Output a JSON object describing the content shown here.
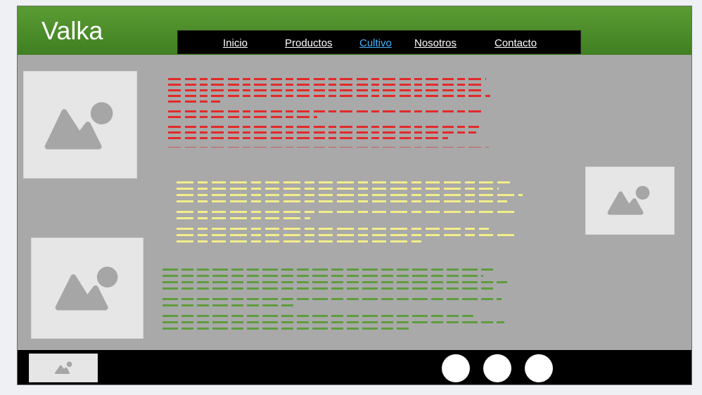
{
  "site": {
    "logo_text": "Valka"
  },
  "nav": {
    "items": [
      {
        "label": "Inicio",
        "active": false
      },
      {
        "label": "Productos",
        "active": false
      },
      {
        "label": "Cultivo",
        "active": true
      },
      {
        "label": "Nosotros",
        "active": false
      },
      {
        "label": "Contacto",
        "active": false
      }
    ],
    "active_color": "#43b4ff"
  },
  "images": [
    {
      "icon": "image-placeholder-icon"
    },
    {
      "icon": "image-placeholder-icon"
    },
    {
      "icon": "image-placeholder-icon"
    },
    {
      "icon": "image-placeholder-icon"
    }
  ],
  "footer": {
    "social_buttons": [
      {
        "icon": "circle-icon"
      },
      {
        "icon": "circle-icon"
      },
      {
        "icon": "circle-icon"
      }
    ]
  },
  "colors": {
    "header_green": "#4a8c2a",
    "text_red": "#e22a2a",
    "text_yellow": "#f3ee8a",
    "text_green": "#5f9c3e",
    "content_bg": "#a9a9a9"
  }
}
